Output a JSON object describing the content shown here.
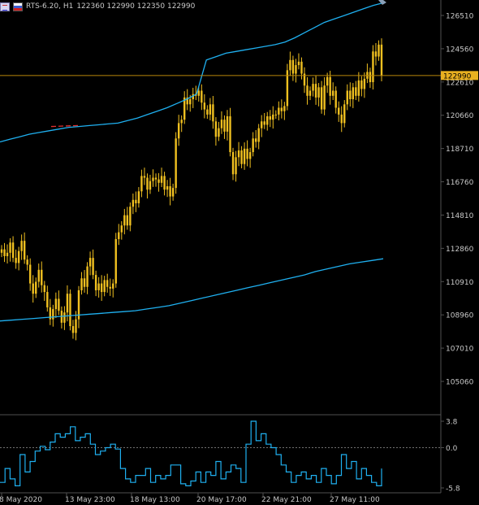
{
  "header": {
    "symbol_info": "RTS-6.20, H1",
    "ohlc": "122360 122990 122350 122990"
  },
  "colors": {
    "candle": "#f0c020",
    "band": "#1fb0f0",
    "price_line": "#b8860b",
    "tag_bg": "#e8b020",
    "grid": "#505050"
  },
  "price_axis": {
    "ticks": [
      "126510",
      "124560",
      "122610",
      "120660",
      "118710",
      "116760",
      "114810",
      "112860",
      "110910",
      "108960",
      "107010",
      "105060"
    ]
  },
  "current_price": "122990",
  "indicator_axis": {
    "top": "3.8",
    "mid": "0.0",
    "bottom": "-5.8"
  },
  "time_axis": {
    "labels": [
      "8 May 2020",
      "13 May 23:00",
      "18 May 13:00",
      "20 May 17:00",
      "22 May 21:00",
      "27 May 11:00"
    ]
  },
  "chart_data": {
    "type": "candlestick",
    "ylim": [
      104000,
      127500
    ],
    "indicator_ylim": [
      -5.8,
      3.8
    ],
    "close_series": [
      112800,
      112400,
      112600,
      113200,
      112300,
      112000,
      112700,
      113300,
      112200,
      111900,
      110800,
      110200,
      110900,
      111600,
      110700,
      110300,
      109400,
      108700,
      109300,
      109900,
      109200,
      108500,
      109100,
      110200,
      108300,
      107900,
      108700,
      110400,
      111100,
      110600,
      111800,
      112300,
      111300,
      110400,
      110800,
      110300,
      111000,
      110600,
      110500,
      110800,
      113400,
      113800,
      114200,
      114800,
      114200,
      115300,
      115700,
      115500,
      116200,
      117100,
      117000,
      116300,
      116800,
      117000,
      116900,
      116700,
      117100,
      116300,
      116500,
      115900,
      116400,
      119300,
      120200,
      120400,
      121700,
      121300,
      121600,
      121900,
      121800,
      122100,
      121400,
      121000,
      120700,
      121300,
      120300,
      119400,
      119900,
      120400,
      119700,
      120600,
      118500,
      117200,
      118200,
      118600,
      117800,
      118700,
      118100,
      118500,
      119300,
      119100,
      119900,
      120300,
      120100,
      120600,
      120400,
      120700,
      120700,
      121100,
      120900,
      121200,
      123300,
      123900,
      123100,
      123600,
      123800,
      123100,
      122400,
      121800,
      122100,
      122500,
      121700,
      122300,
      121000,
      122400,
      122900,
      121800,
      122100,
      121100,
      120700,
      120200,
      121300,
      122100,
      121600,
      122300,
      121800,
      122700,
      122200,
      122800,
      123200,
      122600,
      124400,
      124100,
      124800,
      122990
    ],
    "upper_band": [
      119100,
      119250,
      119400,
      119550,
      119650,
      119750,
      119850,
      119950,
      120000,
      120050,
      120100,
      120150,
      120200,
      120350,
      120500,
      120700,
      120900,
      121100,
      121350,
      121600,
      121900,
      123900,
      124100,
      124300,
      124400,
      124500,
      124600,
      124700,
      124800,
      124950,
      125200,
      125500,
      125800,
      126100,
      126300,
      126500,
      126700,
      126900,
      127100,
      127250
    ],
    "lower_band": [
      108600,
      108650,
      108700,
      108750,
      108800,
      108850,
      108900,
      108950,
      109000,
      109050,
      109100,
      109150,
      109200,
      109300,
      109400,
      109500,
      109650,
      109800,
      109950,
      110100,
      110250,
      110400,
      110550,
      110700,
      110850,
      111000,
      111150,
      111300,
      111500,
      111650,
      111800,
      111950,
      112050,
      112150,
      112250
    ],
    "indicator_values": [
      -5.0,
      -3.0,
      -4.5,
      -5.5,
      -1.0,
      -3.5,
      -2.0,
      -0.5,
      0.2,
      -0.3,
      0.8,
      2.0,
      1.5,
      2.0,
      3.0,
      1.0,
      1.5,
      2.0,
      0.5,
      -1.0,
      -0.5,
      0.0,
      0.5,
      -0.2,
      -3.0,
      -4.5,
      -5.0,
      -4.0,
      -4.0,
      -3.0,
      -5.0,
      -4.0,
      -4.5,
      -4.0,
      -2.5,
      -2.5,
      -5.2,
      -5.5,
      -4.8,
      -3.5,
      -5.0,
      -3.5,
      -4.0,
      -2.0,
      -4.5,
      -3.5,
      -2.5,
      -3.0,
      -5.0,
      0.5,
      3.8,
      1.0,
      2.0,
      0.5,
      0.0,
      -1.0,
      -2.5,
      -3.5,
      -5.0,
      -4.0,
      -3.5,
      -4.5,
      -4.0,
      -5.0,
      -3.0,
      -4.0,
      -5.2,
      -4.0,
      -1.0,
      -3.0,
      -2.0,
      -4.5,
      -3.0,
      -4.0,
      -5.0,
      -5.5,
      -3.0
    ]
  }
}
